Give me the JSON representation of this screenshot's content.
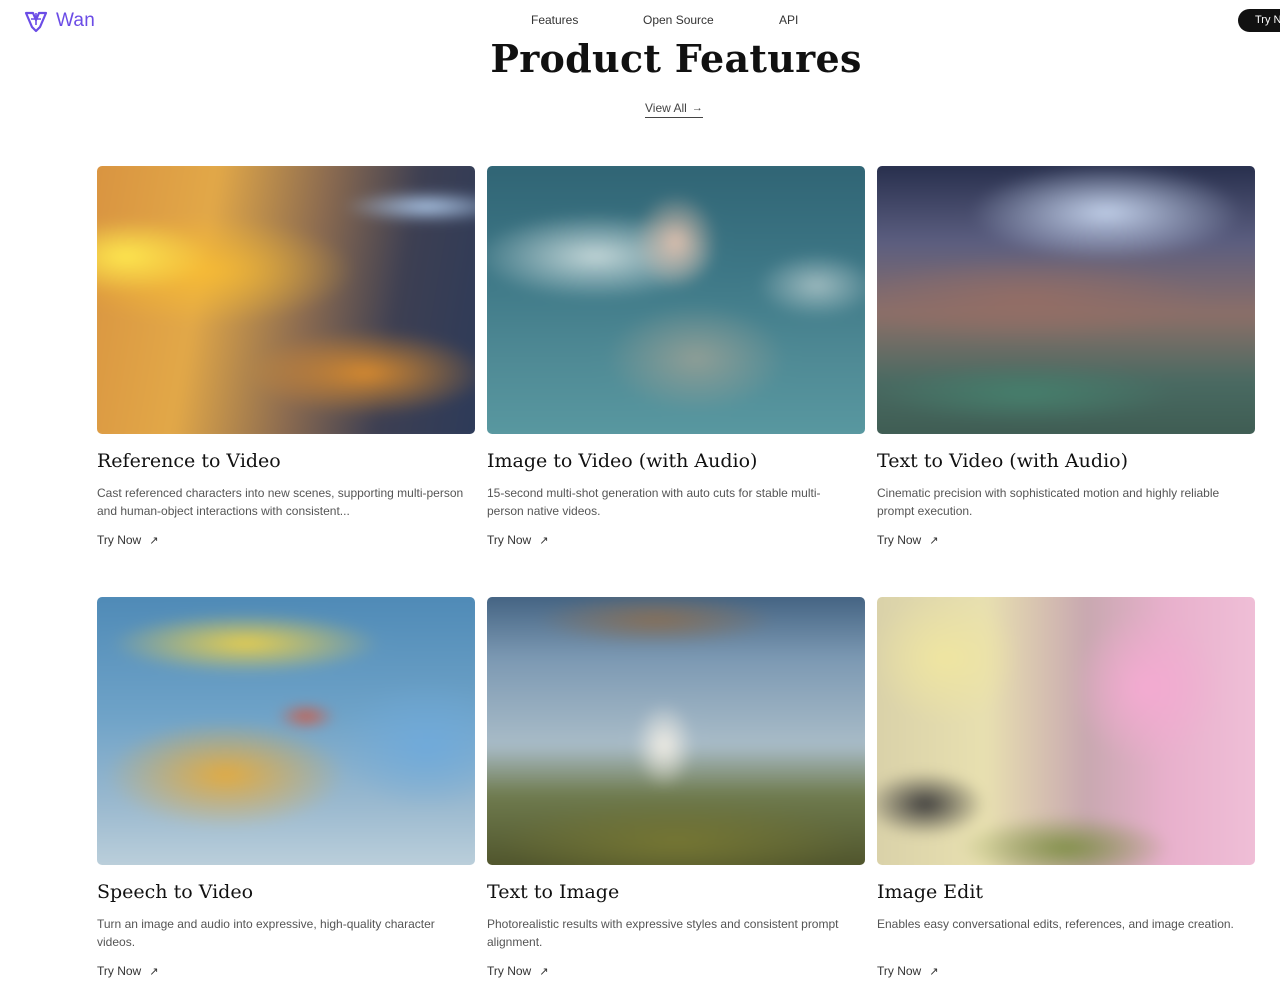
{
  "header": {
    "logo_text": "Wan",
    "nav": [
      "Features",
      "Open Source",
      "API"
    ],
    "try_button": "Try Now"
  },
  "hero": {
    "title": "Product Features",
    "view_all": "View All",
    "view_all_icon": "arrow-right-icon"
  },
  "cards": [
    {
      "title": "Reference to Video",
      "description": "Cast referenced characters into new scenes, supporting multi-person and human-object interactions with consistent...",
      "link": "Try Now"
    },
    {
      "title": "Image to Video (with Audio)",
      "description": "15-second multi-shot generation with auto cuts for stable multi-person native videos.",
      "link": "Try Now"
    },
    {
      "title": "Text to Video (with Audio)",
      "description": "Cinematic precision with sophisticated motion and highly reliable prompt execution.",
      "link": "Try Now"
    },
    {
      "title": "Speech to Video",
      "description": "Turn an image and audio into expressive, high-quality character videos.",
      "link": "Try Now"
    },
    {
      "title": "Text to Image",
      "description": "Photorealistic results with expressive styles and consistent prompt alignment.",
      "link": "Try Now"
    },
    {
      "title": "Image Edit",
      "description": "Enables easy conversational edits, references, and image creation.",
      "link": "Try Now"
    }
  ],
  "colors": {
    "brand": "#6b4ce6",
    "text": "#111111",
    "button_bg": "#111111"
  }
}
